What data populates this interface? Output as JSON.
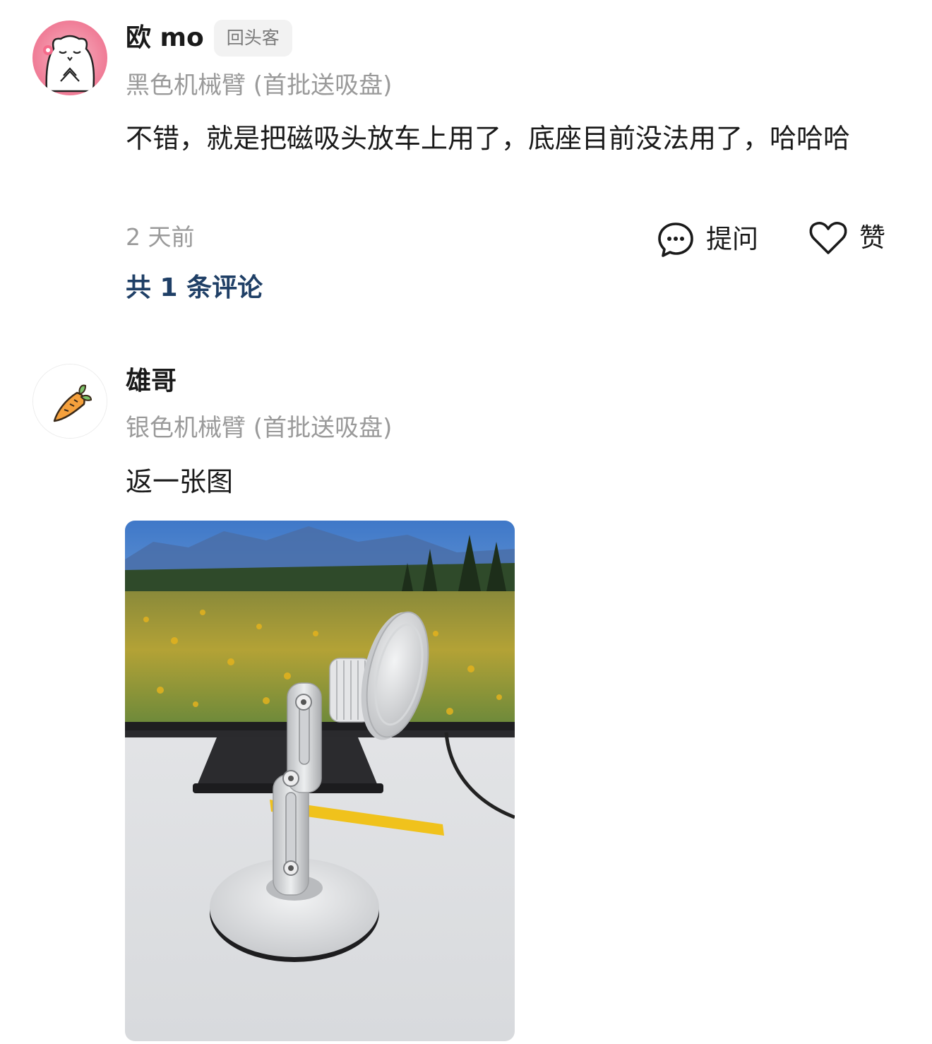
{
  "reviews": [
    {
      "username": "欧 mo",
      "badge": "回头客",
      "variant": "黑色机械臂 (首批送吸盘)",
      "content": "不错，就是把磁吸头放车上用了，底座目前没法用了，哈哈哈",
      "time": "2 天前",
      "ask_label": "提问",
      "like_label": "赞",
      "comments_label": "共 1 条评论",
      "avatar_icon": "bear-avatar-icon"
    },
    {
      "username": "雄哥",
      "variant": "银色机械臂 (首批送吸盘)",
      "content": "返一张图",
      "avatar_icon": "carrot-avatar-icon",
      "photo": "magnetic-phone-stand-photo"
    }
  ],
  "colors": {
    "link": "#1f3f66",
    "muted": "#9a9a9a",
    "badge_bg": "#f2f2f2"
  }
}
